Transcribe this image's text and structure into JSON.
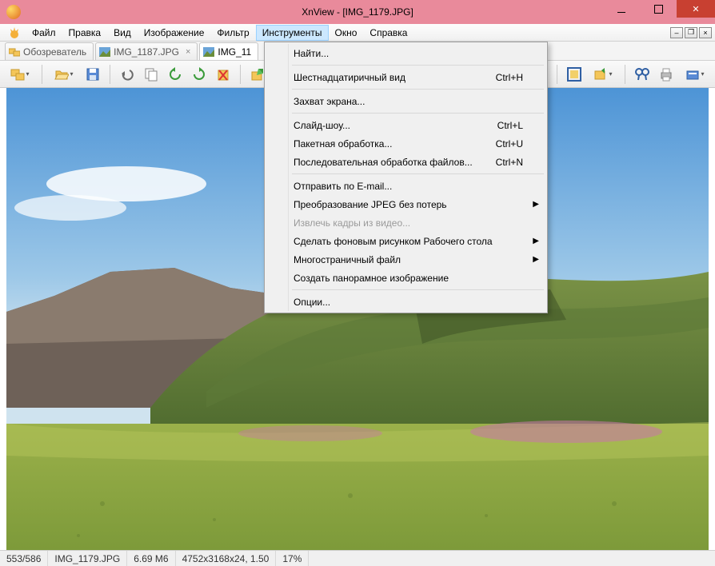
{
  "title": "XnView - [IMG_1179.JPG]",
  "menubar": [
    "Файл",
    "Правка",
    "Вид",
    "Изображение",
    "Фильтр",
    "Инструменты",
    "Окно",
    "Справка"
  ],
  "menubar_active_index": 5,
  "tabs": [
    {
      "label": "Обозреватель",
      "type": "browser"
    },
    {
      "label": "IMG_1187.JPG",
      "type": "img"
    },
    {
      "label": "IMG_11",
      "type": "img",
      "active": true
    }
  ],
  "dropdown": [
    {
      "label": "Найти...",
      "type": "item"
    },
    {
      "type": "sep"
    },
    {
      "label": "Шестнадцатиричный вид",
      "shortcut": "Ctrl+H",
      "type": "item"
    },
    {
      "type": "sep"
    },
    {
      "label": "Захват экрана...",
      "type": "item"
    },
    {
      "type": "sep"
    },
    {
      "label": "Слайд-шоу...",
      "shortcut": "Ctrl+L",
      "type": "item"
    },
    {
      "label": "Пакетная обработка...",
      "shortcut": "Ctrl+U",
      "type": "item"
    },
    {
      "label": "Последовательная обработка файлов...",
      "shortcut": "Ctrl+N",
      "type": "item"
    },
    {
      "type": "sep"
    },
    {
      "label": "Отправить по E-mail...",
      "type": "item"
    },
    {
      "label": "Преобразование JPEG без потерь",
      "submenu": true,
      "type": "item"
    },
    {
      "label": "Извлечь кадры из видео...",
      "disabled": true,
      "type": "item"
    },
    {
      "label": "Сделать фоновым рисунком Рабочего стола",
      "submenu": true,
      "type": "item"
    },
    {
      "label": "Многостраничный файл",
      "submenu": true,
      "type": "item"
    },
    {
      "label": "Создать панорамное изображение",
      "type": "item"
    },
    {
      "type": "sep"
    },
    {
      "label": "Опции...",
      "type": "item"
    }
  ],
  "status": {
    "index": "553/586",
    "filename": "IMG_1179.JPG",
    "filesize": "6.69 М6",
    "dims": "4752x3168x24, 1.50",
    "zoom": "17%"
  }
}
